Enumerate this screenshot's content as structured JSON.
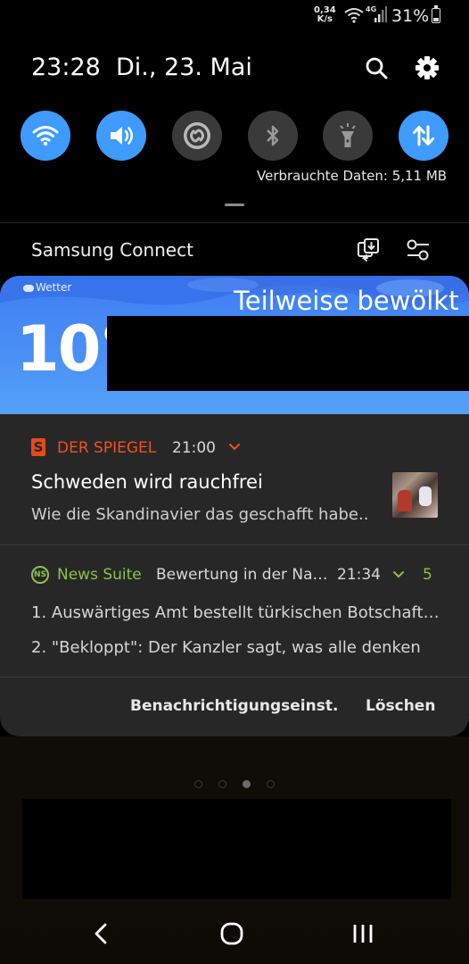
{
  "status_bar": {
    "net_speed_value": "0,34",
    "net_speed_unit": "K/s",
    "network_type": "4G",
    "battery_percent": "31%",
    "battery_level": 0.31
  },
  "header": {
    "time": "23:28",
    "date": "Di., 23. Mai"
  },
  "quick_settings": {
    "toggles": [
      {
        "name": "wifi",
        "icon": "wifi-icon",
        "state": "on"
      },
      {
        "name": "sound",
        "icon": "speaker-icon",
        "state": "on"
      },
      {
        "name": "shazam",
        "icon": "shazam-icon",
        "state": "off"
      },
      {
        "name": "bluetooth",
        "icon": "bluetooth-icon",
        "state": "off"
      },
      {
        "name": "flashlight",
        "icon": "flashlight-icon",
        "state": "off"
      },
      {
        "name": "mobile-data",
        "icon": "data-arrows-icon",
        "state": "on"
      }
    ],
    "data_usage": "Verbrauchte Daten: 5,11 MB",
    "accent_color": "#3f9bff"
  },
  "samsung_connect": {
    "title": "Samsung Connect"
  },
  "weather": {
    "app_label": "Wetter",
    "condition": "Teilweise bewölkt",
    "temperature": "10°"
  },
  "notifications": {
    "spiegel": {
      "app": "DER SPIEGEL",
      "time": "21:00",
      "title": "Schweden wird rauchfrei",
      "body": "Wie die Skandinavier das geschafft habe..",
      "icon_letter": "S",
      "color": "#f25022"
    },
    "news_suite": {
      "app": "News Suite",
      "subtitle": "Bewertung in der Na…",
      "time": "21:34",
      "count": "5",
      "icon_text": "NS",
      "line1": "1. Auswärtiges Amt bestellt türkischen Botschaft…",
      "line2": "2. \"Bekloppt\": Der Kanzler sagt, was alle denken",
      "color": "#8bc34a"
    },
    "actions": {
      "settings_label": "Benachrichtigungseinst.",
      "clear_label": "Löschen"
    }
  },
  "pager": {
    "total": 4,
    "active_index": 2
  }
}
